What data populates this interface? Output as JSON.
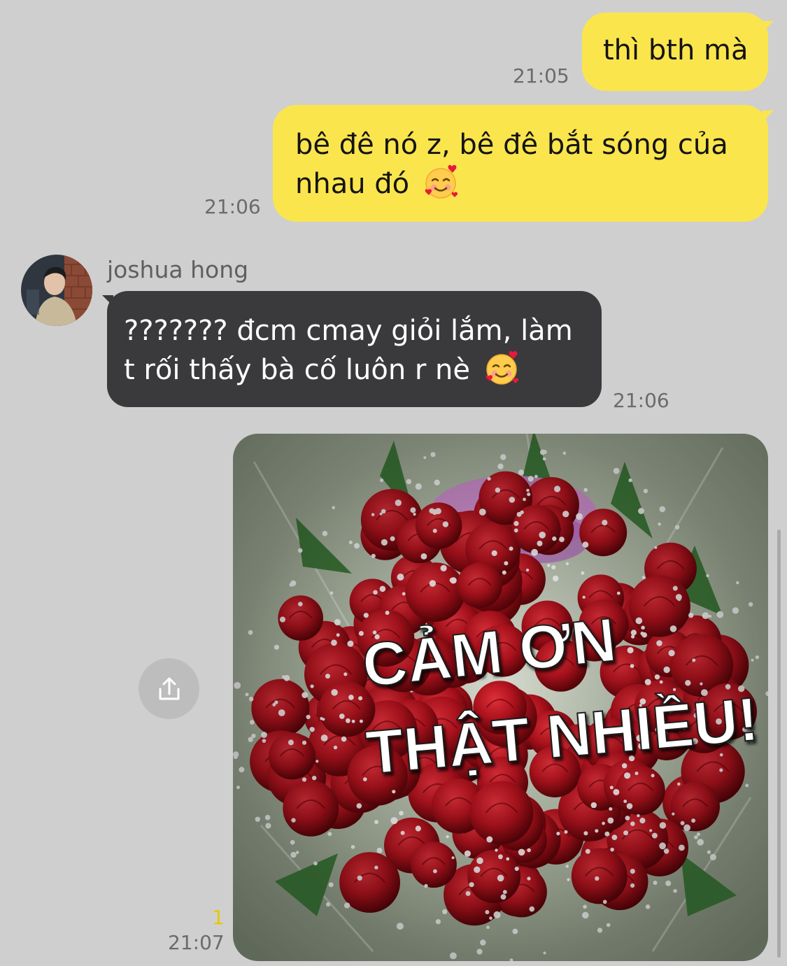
{
  "messages": [
    {
      "direction": "out",
      "text": "thì bth mà",
      "time": "21:05"
    },
    {
      "direction": "out",
      "text": "bê đê nó z, bê đê bắt sóng của nhau đó",
      "emoji": "smiling-face-with-hearts",
      "time": "21:06"
    },
    {
      "direction": "in",
      "sender": "joshua hong",
      "text": "??????? đcm cmay giỏi lắm, làm t rối thấy bà cố luôn r nè",
      "emoji": "smiling-face-with-hearts",
      "time": "21:06"
    },
    {
      "direction": "out",
      "type": "image",
      "image_text_line1": "CẢM ƠN",
      "image_text_line2": "THẬT NHIỀU!",
      "unread": "1",
      "time": "21:07"
    }
  ],
  "colors": {
    "background": "#cfcfcf",
    "outgoing_bubble": "#fbe54d",
    "incoming_bubble": "#3a3a3c",
    "unread_count": "#e8c800"
  },
  "icons": {
    "share": "share-icon",
    "emoji": "smiling-face-with-hearts-icon"
  }
}
